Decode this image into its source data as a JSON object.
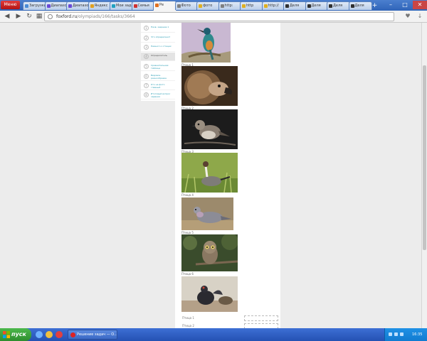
{
  "browser": {
    "menu_label": "Меню",
    "tabs": [
      {
        "label": "Загрузки",
        "color": "#4a8bd6"
      },
      {
        "label": "Диапазон",
        "color": "#6a4ad6"
      },
      {
        "label": "Диапазон",
        "color": "#6a4ad6"
      },
      {
        "label": "Яндекс",
        "color": "#e0a020"
      },
      {
        "label": "Мои задачи",
        "color": "#20a0c0"
      },
      {
        "label": "Семья",
        "color": "#d03030"
      },
      {
        "label": "Ре",
        "color": "#e07020",
        "active": true
      },
      {
        "label": "Фото",
        "color": "#808080"
      },
      {
        "label": "фото",
        "color": "#e0b020"
      },
      {
        "label": "http:",
        "color": "#808080"
      },
      {
        "label": "http",
        "color": "#e0b020"
      },
      {
        "label": "http://",
        "color": "#e0b020"
      },
      {
        "label": "Деля",
        "color": "#303030"
      },
      {
        "label": "Деля",
        "color": "#303030"
      },
      {
        "label": "Деля",
        "color": "#303030"
      },
      {
        "label": "Деля",
        "color": "#303030"
      }
    ],
    "new_tab": "+",
    "url_host": "foxford.ru",
    "url_path": "/olympiads/166/tasks/3664"
  },
  "sidebar": {
    "items": [
      {
        "num": "1",
        "label": "Назв. задание 1"
      },
      {
        "num": "2",
        "label": "Что определено?"
      },
      {
        "num": "3",
        "label": "Немного о птицах"
      },
      {
        "num": "4",
        "label": "Определитель",
        "current": true
      },
      {
        "num": "5",
        "label": "Сравнительная таблица"
      },
      {
        "num": "6",
        "label": "Видовое разнообразие"
      },
      {
        "num": "7",
        "label": "Кто на фото главный"
      },
      {
        "num": "8",
        "label": "Итоговый вопрос задания"
      }
    ]
  },
  "content": {
    "captions": [
      "Птица 1",
      "Птица 2",
      "Птица 3",
      "Птица 4",
      "Птица 5",
      "Птица 6",
      "Птица 7"
    ],
    "answers": [
      {
        "label": "Птица 1",
        "placeholder": ""
      },
      {
        "label": "Птица 2",
        "placeholder": ""
      }
    ]
  },
  "taskbar": {
    "start_label": "пуск",
    "window_label": "Решение задач — O...",
    "clock": "16:35"
  }
}
